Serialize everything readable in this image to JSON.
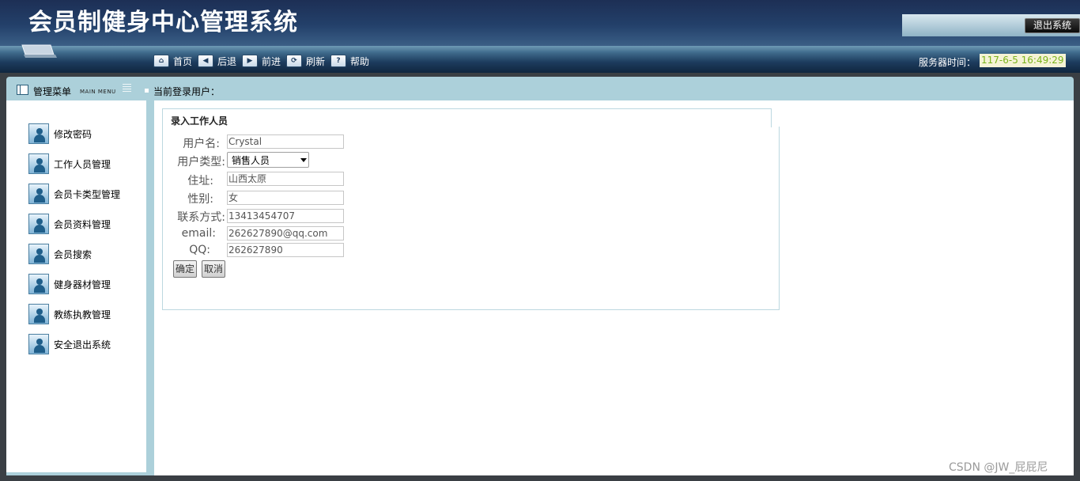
{
  "header": {
    "title": "会员制健身中心管理系统",
    "logout_label": "退出系统"
  },
  "nav": {
    "items": [
      {
        "label": "首页",
        "icon": "home-icon"
      },
      {
        "label": "后退",
        "icon": "back-arrow-icon"
      },
      {
        "label": "前进",
        "icon": "forward-arrow-icon"
      },
      {
        "label": "刷新",
        "icon": "refresh-icon"
      },
      {
        "label": "帮助",
        "icon": "help-icon"
      }
    ],
    "server_time_label": "服务器时间：",
    "server_time_value": "117-6-5 16:49:29"
  },
  "panel": {
    "menu_title": "管理菜单",
    "menu_subtitle": "MAIN MENU",
    "current_user_label": "当前登录用户："
  },
  "sidebar": {
    "items": [
      {
        "label": "修改密码"
      },
      {
        "label": "工作人员管理"
      },
      {
        "label": "会员卡类型管理"
      },
      {
        "label": "会员资料管理"
      },
      {
        "label": "会员搜索"
      },
      {
        "label": "健身器材管理"
      },
      {
        "label": "教练执教管理"
      },
      {
        "label": "安全退出系统"
      }
    ]
  },
  "form": {
    "title": "录入工作人员",
    "username": {
      "label": "用户名:",
      "value": "Crystal"
    },
    "user_type": {
      "label": "用户类型:",
      "value": "销售人员"
    },
    "address": {
      "label": "住址:",
      "value": "山西太原"
    },
    "gender": {
      "label": "性别:",
      "value": "女"
    },
    "contact": {
      "label": "联系方式:",
      "value": "13413454707"
    },
    "email": {
      "label": "email:",
      "value": "262627890@qq.com"
    },
    "qq": {
      "label": "QQ:",
      "value": "262627890"
    },
    "confirm_label": "确定",
    "cancel_label": "取消"
  },
  "watermark": "CSDN @JW_屁屁尼",
  "colors": {
    "header_dark": "#1d2f55",
    "panel_bar": "#acd0da",
    "server_time_text": "#7ab31b"
  }
}
